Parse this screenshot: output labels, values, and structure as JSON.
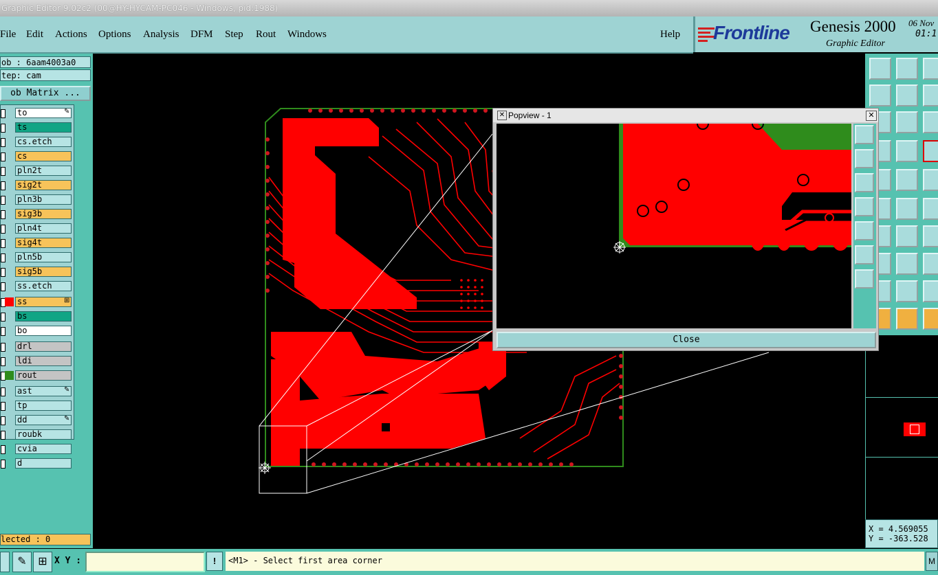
{
  "window": {
    "title": "Graphic Editor 9.02c2 (00@HY-HYCAM-PC046 - Windows, pid:1988)"
  },
  "menu": [
    "File",
    "Edit",
    "Actions",
    "Options",
    "Analysis",
    "DFM",
    "Step",
    "Rout",
    "Windows"
  ],
  "help_label": "Help",
  "brand": {
    "logo": "Frontline",
    "product": "Genesis 2000",
    "subtitle": "Graphic Editor",
    "date": "06 Nov",
    "time": "01:1"
  },
  "job": {
    "job_label": "ob : 6aam4003a0",
    "step_label": "tep: cam",
    "matrix_button": "ob Matrix ..."
  },
  "layers": [
    {
      "name": "to",
      "color": "#ffffff",
      "icon": "edit-icon"
    },
    {
      "name": "ts",
      "color": "#11a585"
    },
    {
      "name": "cs.etch",
      "color": "#b6e4e4"
    },
    {
      "name": "cs",
      "color": "#f7c35a"
    },
    {
      "name": "pln2t",
      "color": "#b6e4e4"
    },
    {
      "name": "sig2t",
      "color": "#f7c35a"
    },
    {
      "name": "pln3b",
      "color": "#b6e4e4"
    },
    {
      "name": "sig3b",
      "color": "#f7c35a"
    },
    {
      "name": "pln4t",
      "color": "#b6e4e4"
    },
    {
      "name": "sig4t",
      "color": "#f7c35a"
    },
    {
      "name": "pln5b",
      "color": "#b6e4e4"
    },
    {
      "name": "sig5b",
      "color": "#f7c35a"
    },
    {
      "name": "ss.etch",
      "color": "#b6e4e4"
    },
    {
      "name": "ss",
      "color": "#f7c35a",
      "swatch": "#ff0000",
      "icon": "plus-box-icon"
    },
    {
      "name": "bs",
      "color": "#11a585"
    },
    {
      "name": "bo",
      "color": "#ffffff"
    },
    {
      "name": "drl",
      "color": "#c4c4c4"
    },
    {
      "name": "ldi",
      "color": "#c4c4c4"
    },
    {
      "name": "rout",
      "color": "#c4c4c4",
      "swatch": "#2f8c1c"
    },
    {
      "name": "ast",
      "color": "#b6e4e4",
      "icon": "edit-icon"
    },
    {
      "name": "tp",
      "color": "#b6e4e4"
    },
    {
      "name": "dd",
      "color": "#b6e4e4",
      "icon": "edit-icon"
    },
    {
      "name": "roubk",
      "color": "#b6e4e4"
    },
    {
      "name": "cvia",
      "color": "#b6e4e4"
    },
    {
      "name": "d",
      "color": "#b6e4e4"
    }
  ],
  "selected_label": "lected : 0",
  "coords": {
    "x": "X = 4.569055",
    "y": "Y = -363.528"
  },
  "bottom": {
    "xy_label": "X Y :",
    "prompt": "<M1> - Select first area corner",
    "right_button": "M"
  },
  "popview": {
    "title": "Popview - 1",
    "close_label": "Close"
  },
  "colors": {
    "copper": "#ff0000",
    "panel": "#56c2b0",
    "menubar": "#9ed3d3",
    "outline": "#2f8c1c"
  }
}
